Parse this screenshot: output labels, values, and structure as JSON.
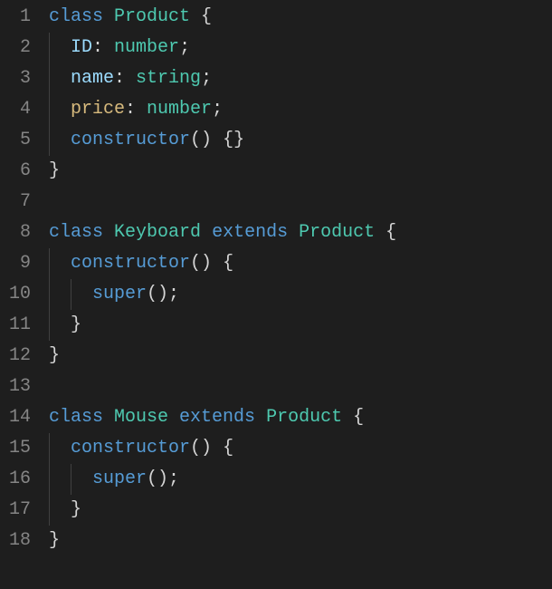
{
  "lines": [
    {
      "n": 1,
      "segments": [
        {
          "cls": "kw",
          "t": "class "
        },
        {
          "cls": "type",
          "t": "Product "
        },
        {
          "cls": "brace",
          "t": "{"
        }
      ],
      "indent": 0,
      "guides": []
    },
    {
      "n": 2,
      "segments": [
        {
          "cls": "prop",
          "t": "ID"
        },
        {
          "cls": "punc",
          "t": ": "
        },
        {
          "cls": "type",
          "t": "number"
        },
        {
          "cls": "punc",
          "t": ";"
        }
      ],
      "indent": 2,
      "guides": [
        0
      ]
    },
    {
      "n": 3,
      "segments": [
        {
          "cls": "prop",
          "t": "name"
        },
        {
          "cls": "punc",
          "t": ": "
        },
        {
          "cls": "type",
          "t": "string"
        },
        {
          "cls": "punc",
          "t": ";"
        }
      ],
      "indent": 2,
      "guides": [
        0
      ]
    },
    {
      "n": 4,
      "segments": [
        {
          "cls": "prop2",
          "t": "price"
        },
        {
          "cls": "punc",
          "t": ": "
        },
        {
          "cls": "type",
          "t": "number"
        },
        {
          "cls": "punc",
          "t": ";"
        }
      ],
      "indent": 2,
      "guides": [
        0
      ]
    },
    {
      "n": 5,
      "segments": [
        {
          "cls": "kw",
          "t": "constructor"
        },
        {
          "cls": "punc",
          "t": "() "
        },
        {
          "cls": "brace",
          "t": "{}"
        }
      ],
      "indent": 2,
      "guides": [
        0
      ]
    },
    {
      "n": 6,
      "segments": [
        {
          "cls": "brace",
          "t": "}"
        }
      ],
      "indent": 0,
      "guides": []
    },
    {
      "n": 7,
      "segments": [],
      "indent": 0,
      "guides": []
    },
    {
      "n": 8,
      "segments": [
        {
          "cls": "kw",
          "t": "class "
        },
        {
          "cls": "type",
          "t": "Keyboard "
        },
        {
          "cls": "kw",
          "t": "extends "
        },
        {
          "cls": "type",
          "t": "Product "
        },
        {
          "cls": "brace",
          "t": "{"
        }
      ],
      "indent": 0,
      "guides": []
    },
    {
      "n": 9,
      "segments": [
        {
          "cls": "kw",
          "t": "constructor"
        },
        {
          "cls": "punc",
          "t": "() "
        },
        {
          "cls": "brace",
          "t": "{"
        }
      ],
      "indent": 2,
      "guides": [
        0
      ]
    },
    {
      "n": 10,
      "segments": [
        {
          "cls": "kw",
          "t": "super"
        },
        {
          "cls": "punc",
          "t": "();"
        }
      ],
      "indent": 4,
      "guides": [
        0,
        2
      ]
    },
    {
      "n": 11,
      "segments": [
        {
          "cls": "brace",
          "t": "}"
        }
      ],
      "indent": 2,
      "guides": [
        0
      ]
    },
    {
      "n": 12,
      "segments": [
        {
          "cls": "brace",
          "t": "}"
        }
      ],
      "indent": 0,
      "guides": []
    },
    {
      "n": 13,
      "segments": [],
      "indent": 0,
      "guides": []
    },
    {
      "n": 14,
      "segments": [
        {
          "cls": "kw",
          "t": "class "
        },
        {
          "cls": "type",
          "t": "Mouse "
        },
        {
          "cls": "kw",
          "t": "extends "
        },
        {
          "cls": "type",
          "t": "Product "
        },
        {
          "cls": "brace",
          "t": "{"
        }
      ],
      "indent": 0,
      "guides": []
    },
    {
      "n": 15,
      "segments": [
        {
          "cls": "kw",
          "t": "constructor"
        },
        {
          "cls": "punc",
          "t": "() "
        },
        {
          "cls": "brace",
          "t": "{"
        }
      ],
      "indent": 2,
      "guides": [
        0
      ]
    },
    {
      "n": 16,
      "segments": [
        {
          "cls": "kw",
          "t": "super"
        },
        {
          "cls": "punc",
          "t": "();"
        }
      ],
      "indent": 4,
      "guides": [
        0,
        2
      ]
    },
    {
      "n": 17,
      "segments": [
        {
          "cls": "brace",
          "t": "}"
        }
      ],
      "indent": 2,
      "guides": [
        0
      ]
    },
    {
      "n": 18,
      "segments": [
        {
          "cls": "brace",
          "t": "}"
        }
      ],
      "indent": 0,
      "guides": []
    }
  ]
}
